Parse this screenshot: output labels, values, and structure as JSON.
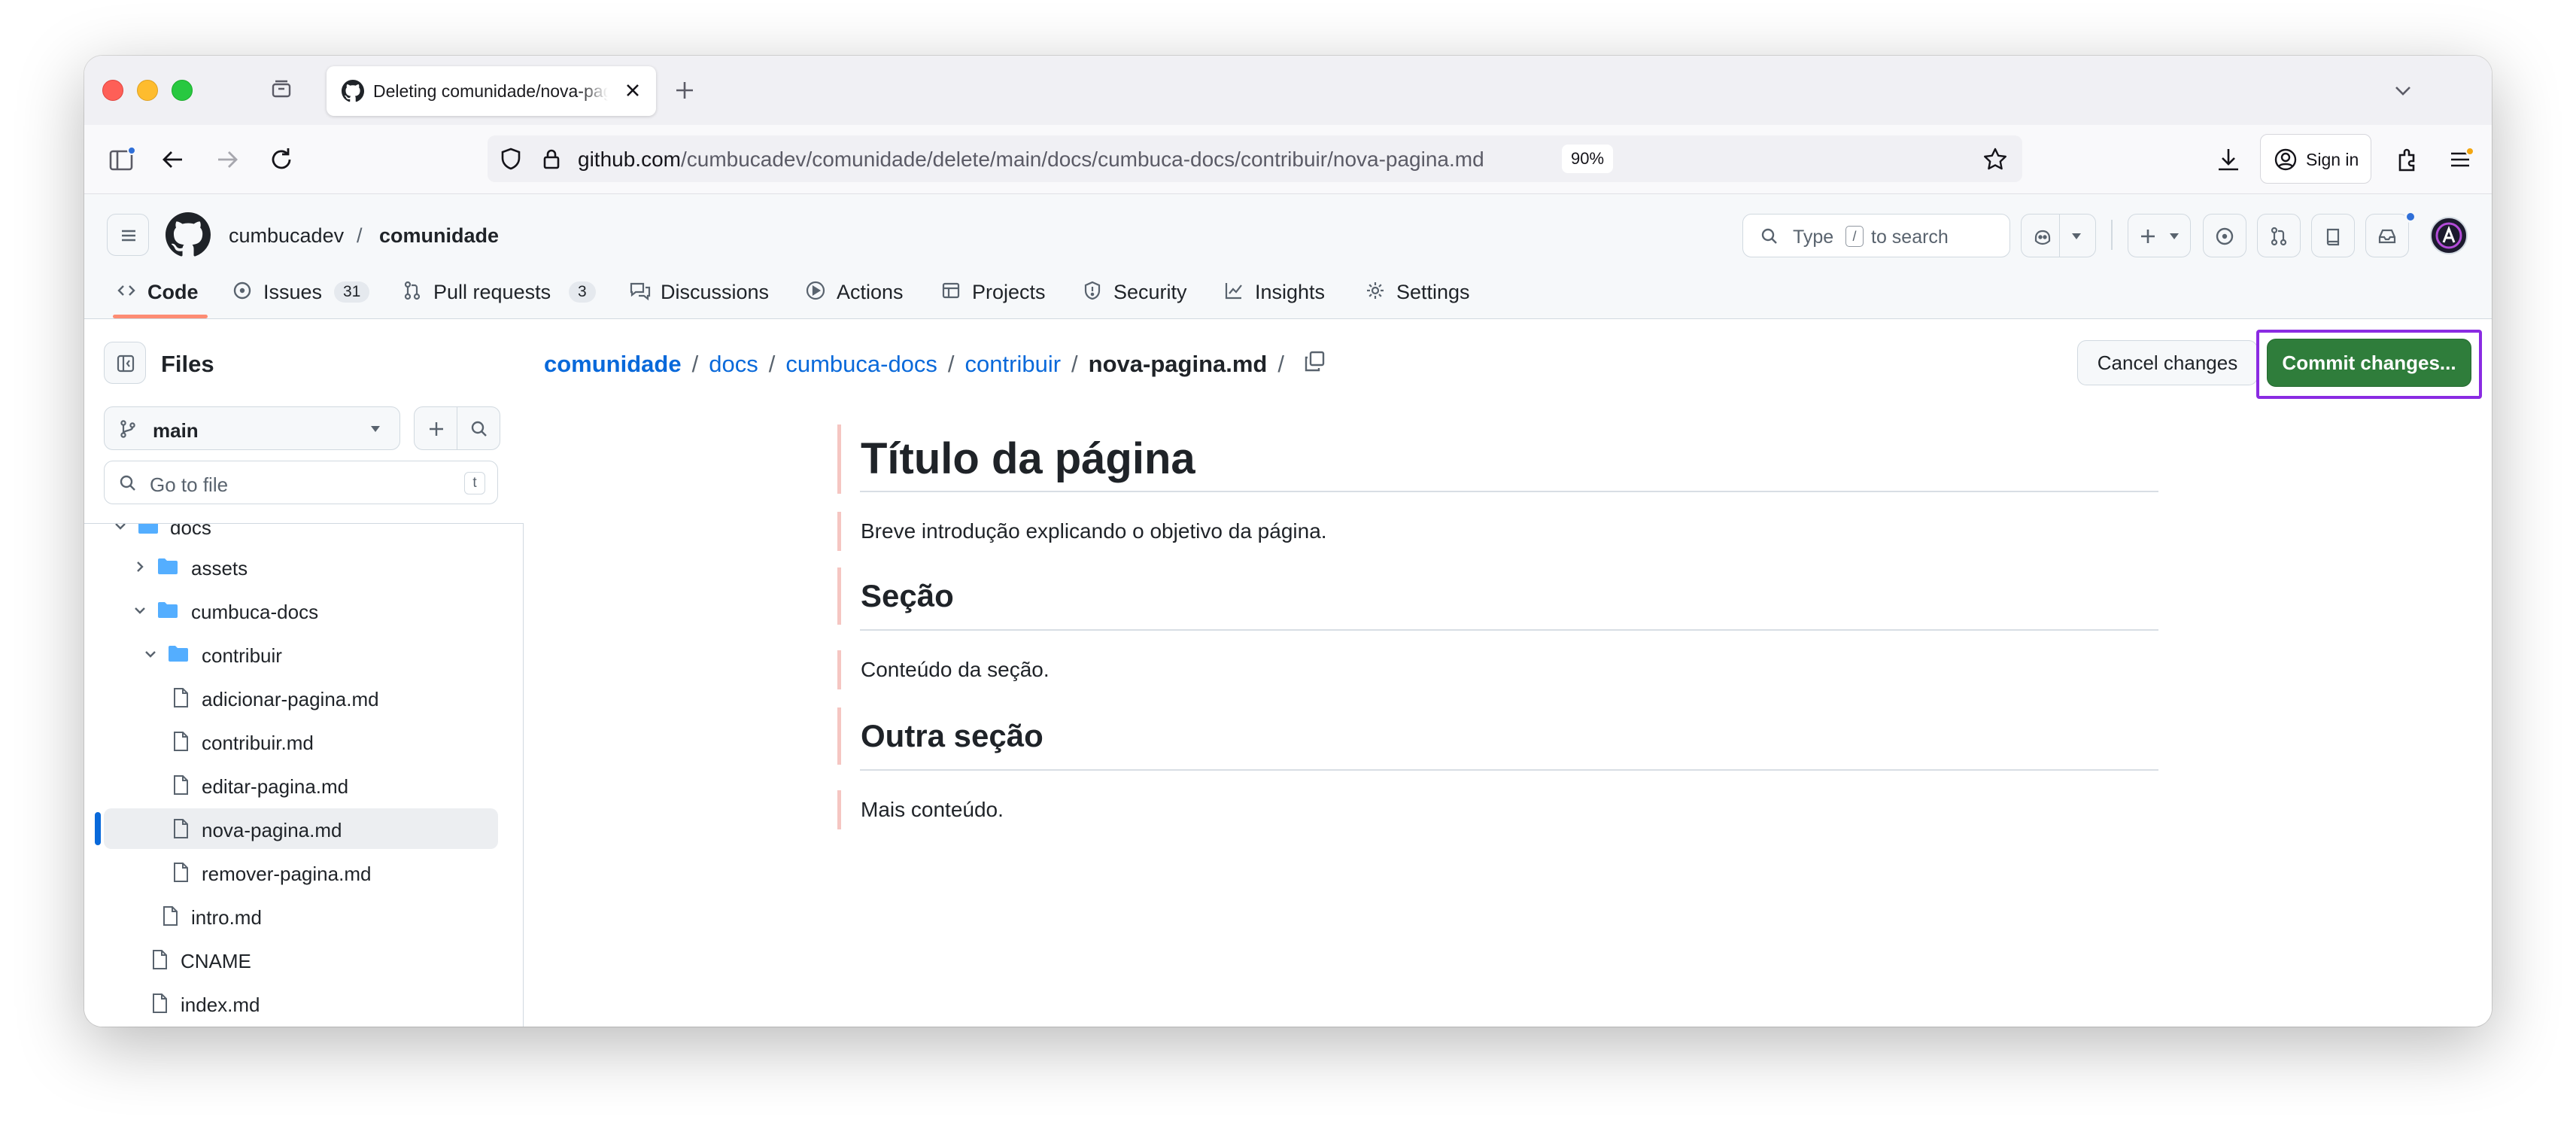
{
  "browser": {
    "tab_title": "Deleting comunidade/nova-pagina.md at main · cumbucadev/comunidade",
    "url_host": "github.com",
    "url_path": "/cumbucadev/comunidade/delete/main/docs/cumbuca-docs/contribuir/nova-pagina.md",
    "zoom": "90%",
    "sign_in_label": "Sign in"
  },
  "header": {
    "owner": "cumbucadev",
    "separator": "/",
    "repo": "comunidade",
    "search": {
      "prefix": "Type",
      "key": "/",
      "suffix": "to search"
    }
  },
  "repo_nav": [
    {
      "label": "Code",
      "count": ""
    },
    {
      "label": "Issues",
      "count": "31"
    },
    {
      "label": "Pull requests",
      "count": "3"
    },
    {
      "label": "Discussions",
      "count": ""
    },
    {
      "label": "Actions",
      "count": ""
    },
    {
      "label": "Projects",
      "count": ""
    },
    {
      "label": "Security",
      "count": ""
    },
    {
      "label": "Insights",
      "count": ""
    },
    {
      "label": "Settings",
      "count": ""
    }
  ],
  "sidebar": {
    "title": "Files",
    "branch": "main",
    "go_to_file_placeholder": "Go to file",
    "go_to_file_key": "t",
    "tree": [
      {
        "name": "docs",
        "type": "folder",
        "expanded": true
      },
      {
        "name": "assets",
        "type": "folder",
        "expanded": false
      },
      {
        "name": "cumbuca-docs",
        "type": "folder",
        "expanded": true
      },
      {
        "name": "contribuir",
        "type": "folder",
        "expanded": true
      },
      {
        "name": "adicionar-pagina.md",
        "type": "file"
      },
      {
        "name": "contribuir.md",
        "type": "file"
      },
      {
        "name": "editar-pagina.md",
        "type": "file"
      },
      {
        "name": "nova-pagina.md",
        "type": "file",
        "active": true
      },
      {
        "name": "remover-pagina.md",
        "type": "file"
      },
      {
        "name": "intro.md",
        "type": "file"
      },
      {
        "name": "CNAME",
        "type": "file"
      },
      {
        "name": "index.md",
        "type": "file"
      }
    ]
  },
  "main": {
    "breadcrumb": [
      "comunidade",
      "docs",
      "cumbuca-docs",
      "contribuir"
    ],
    "breadcrumb_current": "nova-pagina.md",
    "breadcrumb_sep": "/",
    "cancel_label": "Cancel changes",
    "commit_label": "Commit changes...",
    "doc": {
      "title": "Título da página",
      "intro": "Breve introdução explicando o objetivo da página.",
      "section1": "Seção",
      "section1_text": "Conteúdo da seção.",
      "section2": "Outra seção",
      "section2_text": "Mais conteúdo."
    }
  },
  "colors": {
    "accent_link": "#0969da",
    "commit_green": "#2f7d3b",
    "highlight_frame": "#8a2be2",
    "tab_underline": "#fd8c73",
    "deleted_marker": "#f5c6c2"
  }
}
